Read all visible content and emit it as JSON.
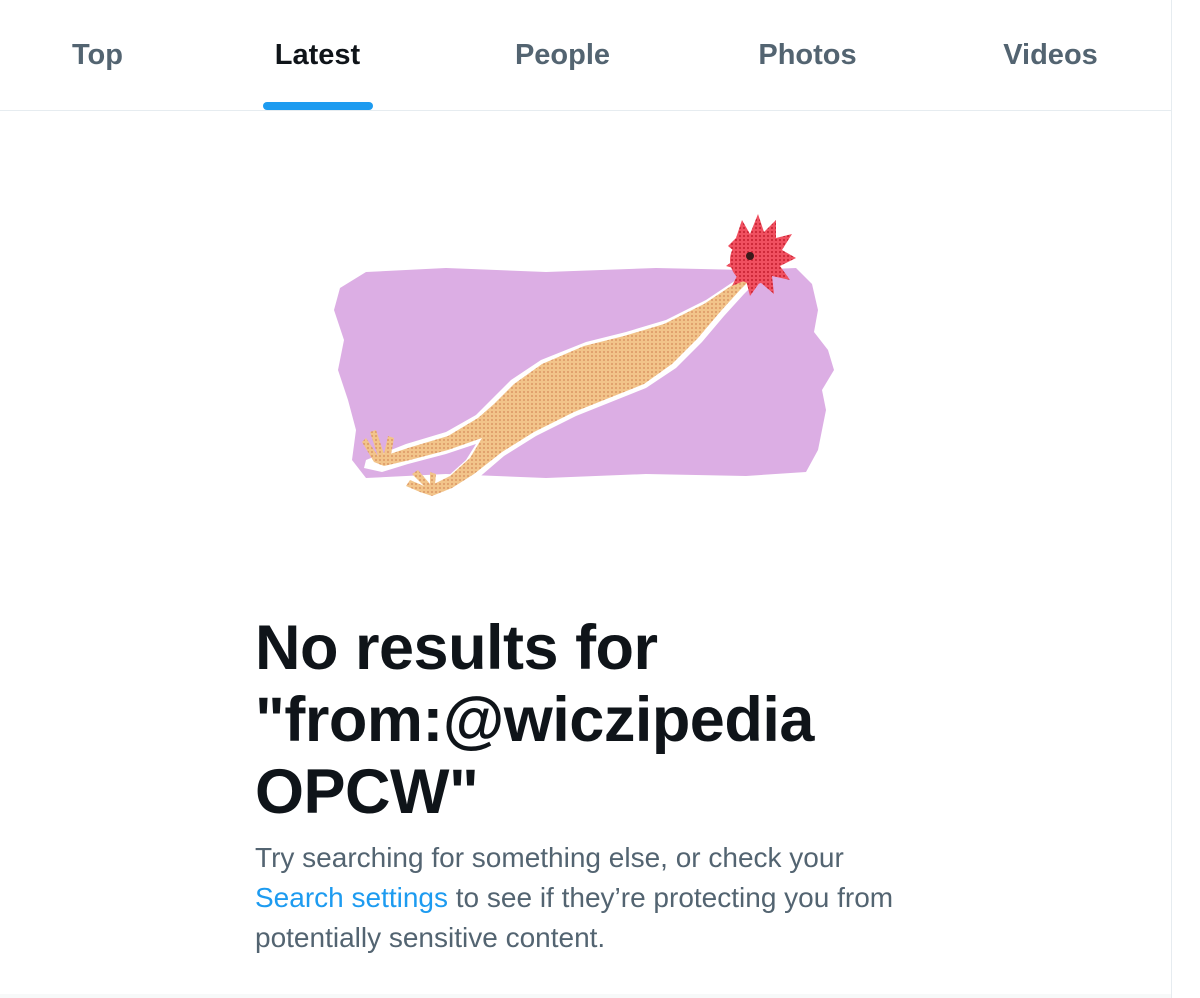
{
  "tabs": [
    {
      "label": "Top",
      "active": false
    },
    {
      "label": "Latest",
      "active": true
    },
    {
      "label": "People",
      "active": false
    },
    {
      "label": "Photos",
      "active": false
    },
    {
      "label": "Videos",
      "active": false
    }
  ],
  "empty_state": {
    "illustration": "rubber-chicken-icon",
    "headline_line1": "No results for",
    "headline_line2": "\"from:@wiczipedia",
    "headline_line3": "OPCW\"",
    "message_before_link": "Try searching for something else, or check your ",
    "link_text": "Search settings",
    "message_after_link": " to see if they’re protecting you from potentially sensitive content."
  },
  "colors": {
    "accent": "#1d9bf0",
    "text_primary": "#0f1419",
    "text_secondary": "#536471",
    "illustration_background": "#dcaee4"
  }
}
